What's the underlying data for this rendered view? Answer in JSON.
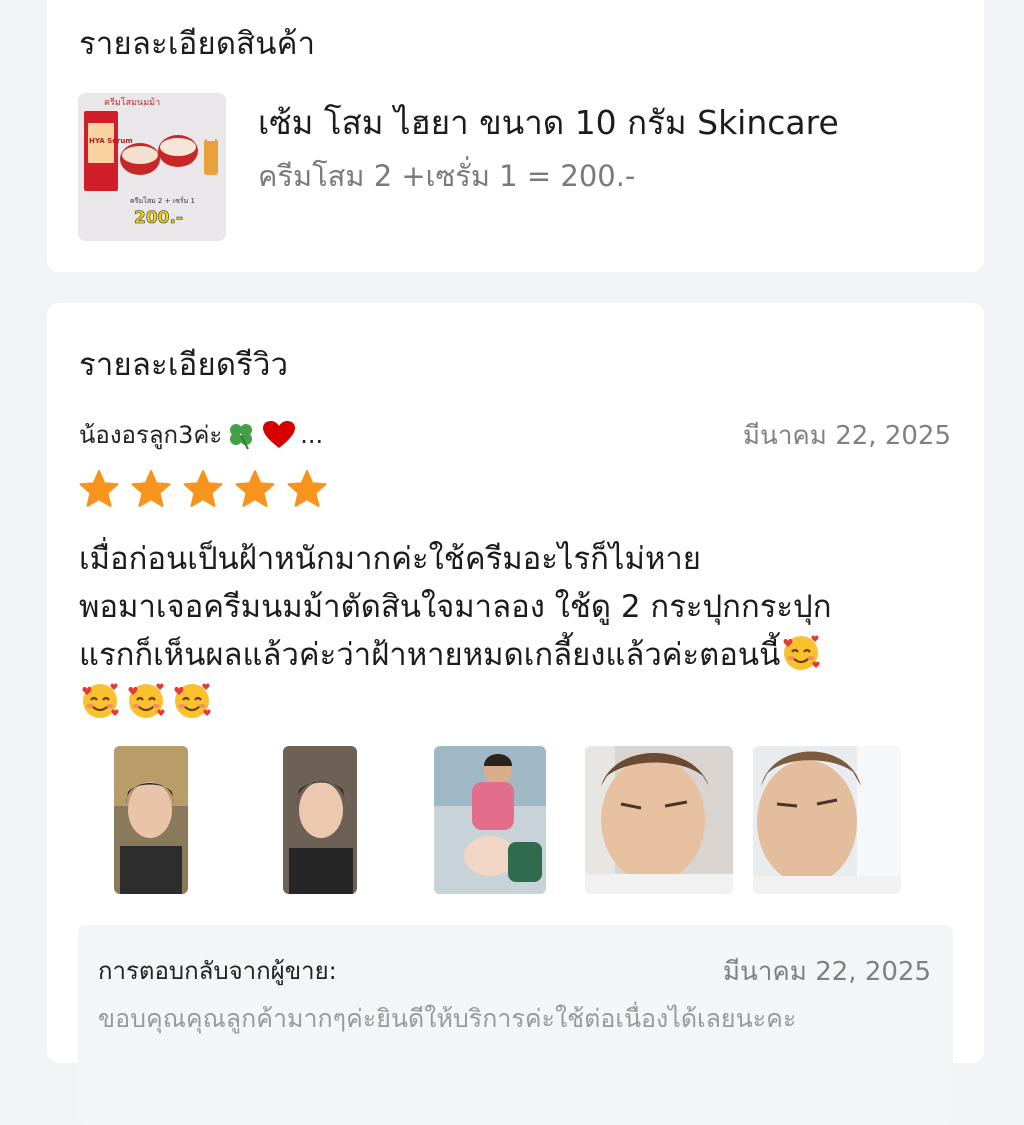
{
  "product_section": {
    "title": "รายละเอียดสินค้า",
    "product_name": "เซ้ม โสม ไฮยา ขนาด 10 กรัม Skincare",
    "variant": "ครีมโสม 2 +เซรั่ม 1 = 200.-",
    "thumb_text": {
      "top_label": "ครีมโสมนมม้า",
      "box_label": "HYA Serum",
      "bottom_label": "ครีมโสม 2 + เซรั่ม 1",
      "price": "200.-"
    }
  },
  "review_section": {
    "title": "รายละเอียดรีวิว",
    "reviewer": "น้องอรลูก3ค่ะ",
    "reviewer_ellipsis": "...",
    "date": "มีนาคม 22, 2025",
    "rating": 5,
    "text_line1": "เมื่อก่อนเป็นฝ้าหนักมากค่ะใช้ครีมอะไรก็ไม่หาย",
    "text_line2": "พอมาเจอครีมนมม้าตัดสินใจมาลอง ใช้ดู 2 กระปุกกระปุก",
    "text_line3": "แรกก็เห็นผลแล้วค่ะว่าฝ้าหายหมดเกลี้ยงแล้วค่ะตอนนี้",
    "photos": [
      "review-photo-1",
      "review-photo-2",
      "review-photo-3",
      "review-photo-4",
      "review-photo-5"
    ]
  },
  "seller_reply": {
    "label": "การตอบกลับจากผู้ขาย:",
    "date": "มีนาคม 22, 2025",
    "text": "ขอบคุณคุณลูกค้ามากๆค่ะยินดีให้บริการค่ะใช้ต่อเนื่องได้เลยนะคะ"
  },
  "colors": {
    "star": "#f7941d",
    "background": "#f1f3f6",
    "card": "#ffffff",
    "muted_text": "#808080"
  }
}
